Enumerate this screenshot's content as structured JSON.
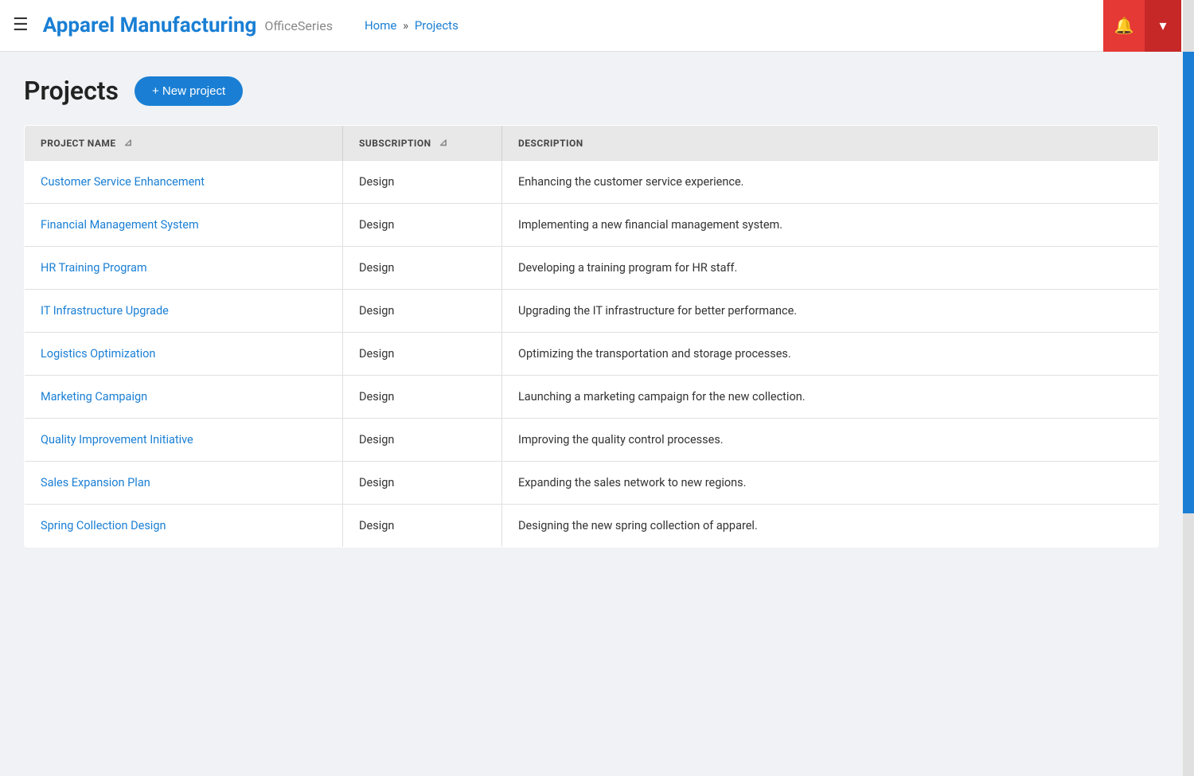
{
  "header": {
    "hamburger_label": "☰",
    "brand_title": "Apparel Manufacturing",
    "brand_sub": "OfficeSeries",
    "breadcrumb": {
      "home": "Home",
      "separator": "»",
      "current": "Projects"
    },
    "bell_icon": "🔔",
    "dropdown_icon": "▾"
  },
  "page": {
    "title": "Projects",
    "new_project_btn": "+ New project"
  },
  "table": {
    "columns": [
      {
        "key": "name",
        "label": "PROJECT NAME",
        "filterable": true
      },
      {
        "key": "subscription",
        "label": "SUBSCRIPTION",
        "filterable": true
      },
      {
        "key": "description",
        "label": "DESCRIPTION",
        "filterable": false
      }
    ],
    "rows": [
      {
        "name": "Customer Service Enhancement",
        "subscription": "Design",
        "description": "Enhancing the customer service experience."
      },
      {
        "name": "Financial Management System",
        "subscription": "Design",
        "description": "Implementing a new financial management system."
      },
      {
        "name": "HR Training Program",
        "subscription": "Design",
        "description": "Developing a training program for HR staff."
      },
      {
        "name": "IT Infrastructure Upgrade",
        "subscription": "Design",
        "description": "Upgrading the IT infrastructure for better performance."
      },
      {
        "name": "Logistics Optimization",
        "subscription": "Design",
        "description": "Optimizing the transportation and storage processes."
      },
      {
        "name": "Marketing Campaign",
        "subscription": "Design",
        "description": "Launching a marketing campaign for the new collection."
      },
      {
        "name": "Quality Improvement Initiative",
        "subscription": "Design",
        "description": "Improving the quality control processes."
      },
      {
        "name": "Sales Expansion Plan",
        "subscription": "Design",
        "description": "Expanding the sales network to new regions."
      },
      {
        "name": "Spring Collection Design",
        "subscription": "Design",
        "description": "Designing the new spring collection of apparel."
      }
    ]
  }
}
